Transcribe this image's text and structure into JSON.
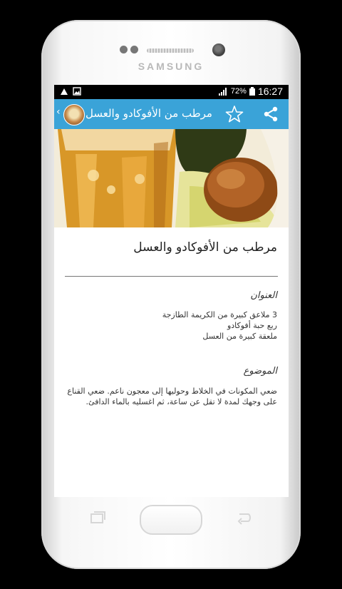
{
  "device": {
    "brand": "SAMSUNG"
  },
  "status_bar": {
    "battery_percent": "72%",
    "time": "16:27"
  },
  "app_bar": {
    "back_glyph": "‹",
    "title": "مرطب من الأفوكادو والعسل",
    "icons": [
      "app-logo",
      "star-icon",
      "share-icon"
    ]
  },
  "article": {
    "title": "مرطب من الأفوكادو والعسل",
    "ingredients_heading": "العنوان",
    "ingredients": [
      "3 ملاعق كبيرة من الكريمة الطازجة",
      "ربع حبة أفوكادو",
      "ملعقة كبيرة من العسل"
    ],
    "method_heading": "الموضوع",
    "method_text": "ضعي المكونات في الخلاط وحوليها إلى معجون ناعم. ضعي القناع على وجهك لمدة لا تقل عن ساعة، ثم اغسليه بالماء الدافئ."
  },
  "colors": {
    "app_bar": "#3aa3d8",
    "status_bar": "#000000",
    "screen_bg": "#ffffff"
  }
}
